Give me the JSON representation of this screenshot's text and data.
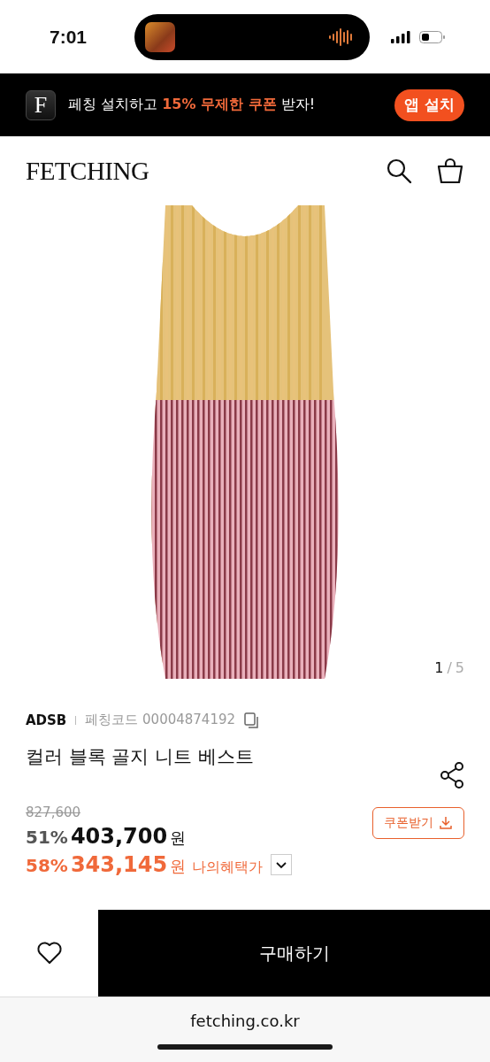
{
  "status_bar": {
    "time": "7:01"
  },
  "app_banner": {
    "logo_letter": "F",
    "message": [
      {
        "text": "페칭 설치하고 ",
        "highlight": false
      },
      {
        "text": "15% 무제한 쿠폰",
        "highlight": true
      },
      {
        "text": " 받자!",
        "highlight": false
      }
    ],
    "install_button": "앱 설치"
  },
  "header": {
    "logo": "FETCHING"
  },
  "gallery": {
    "counter_current": "1",
    "counter_separator": "/",
    "counter_total": "5"
  },
  "product": {
    "brand": "ADSB",
    "code_label": "페칭코드 00004874192",
    "name": "컬러 블록 골지 니트 베스트",
    "original_price": "827,600",
    "sale": {
      "discount": "51%",
      "price": "403,700",
      "currency": "원"
    },
    "benefit": {
      "discount": "58%",
      "price": "343,145",
      "currency": "원",
      "label": "나의혜택가",
      "expanded": false
    },
    "coupon_button": "쿠폰받기"
  },
  "bottom_bar": {
    "wishlisted": false,
    "buy_button": "구매하기"
  },
  "browser": {
    "url": "fetching.co.kr"
  }
}
